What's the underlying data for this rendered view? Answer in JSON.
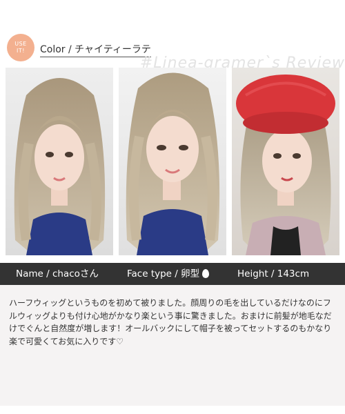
{
  "header": {
    "badge_line1": "USE",
    "badge_line2": "IT!",
    "color_title": "Color / チャイティーラテ",
    "watermark": "#Linea-gramer`s Review"
  },
  "photos": [
    {
      "description_icon": "model-photo-1"
    },
    {
      "description_icon": "model-photo-2"
    },
    {
      "description_icon": "model-photo-3"
    }
  ],
  "info": {
    "name": "Name / chacoさん",
    "face_type": "Face type / 卵型",
    "height": "Height / 143cm"
  },
  "review": {
    "text": "ハーフウィッグというものを初めて被りました。顔周りの毛を出しているだけなのにフルウィッグよりも付け心地がかなり楽という事に驚きました。おまけに前髪が地毛なだけでぐんと自然度が増します！オールバックにして帽子を被ってセットするのもかなり楽で可愛くてお気に入りです♡"
  },
  "colors": {
    "badge": "#f3b08f",
    "info_bar": "#333333",
    "review_bg": "#f5f3f3",
    "hair": "#b8a78c",
    "beret": "#d9363a",
    "top": "#2a3b86"
  }
}
